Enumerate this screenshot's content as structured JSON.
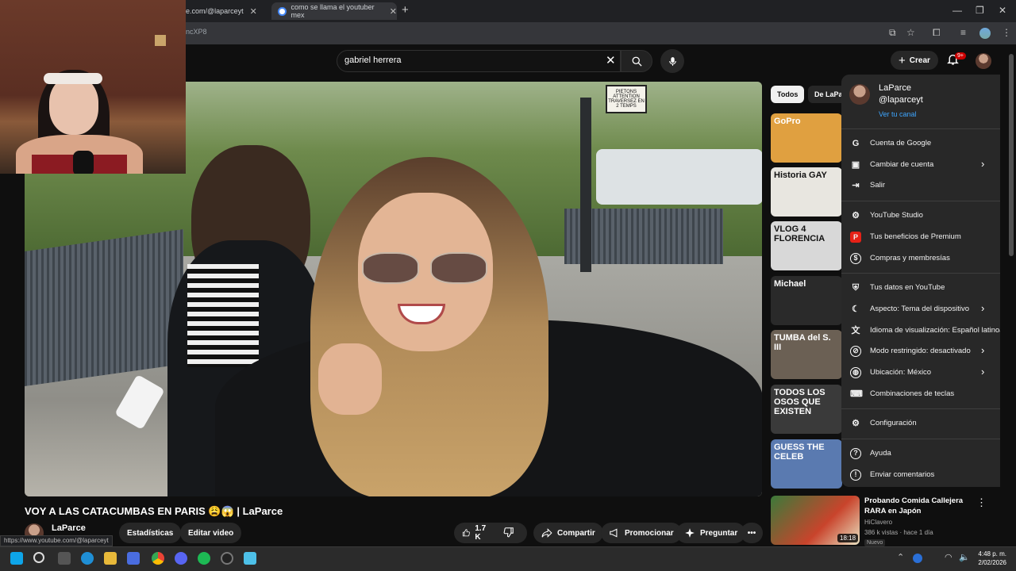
{
  "browser": {
    "tab1_label": "e.com/@laparceyt",
    "tab2_label": "como se llama el youtuber mex",
    "new_tab": "+",
    "address": "ncXP8",
    "status_url": "https://www.youtube.com/@laparceyt"
  },
  "header": {
    "search_value": "gabriel herrera",
    "create_label": "Crear",
    "notif_badge": "9+"
  },
  "video": {
    "title": "VOY A LAS CATACUMBAS EN PARIS 😩😱 | LaParce",
    "channel": "LaParce",
    "sign_text": "PIETONS ATTENTION TRAVERSEZ EN 2 TEMPS",
    "buttons": {
      "stats": "Estadísticas",
      "edit": "Editar video",
      "likes": "1.7 K",
      "share": "Compartir",
      "promote": "Promocionar",
      "ask": "Preguntar",
      "more": "•••"
    }
  },
  "sidebar": {
    "chips": [
      "Todos",
      "De LaPa"
    ],
    "thumbs": [
      {
        "text": "GoPro",
        "color": "#e0a040"
      },
      {
        "text": "Historia GAY",
        "color": "#e8e6e0"
      },
      {
        "text": "VLOG 4 FLORENCIA",
        "color": "#d8d8d8"
      },
      {
        "text": "Michael",
        "color": "#2a2a2a"
      },
      {
        "text": "TUMBA del S. III",
        "color": "#6b6054"
      },
      {
        "text": "TODOS LOS OSOS QUE EXISTEN",
        "color": "#3a3a3a"
      },
      {
        "text": "GUESS THE CELEB",
        "color": "#5a7ab0"
      }
    ],
    "recommendation": {
      "title": "Probando Comida Callejera RARA en Japón",
      "channel": "HiClavero",
      "meta": "386 k vistas · hace 1 día",
      "badge": "Nuevo",
      "duration": "18:18"
    }
  },
  "account_menu": {
    "name": "LaParce",
    "handle": "@laparceyt",
    "view_channel": "Ver tu canal",
    "groups": [
      [
        {
          "label": "Cuenta de Google",
          "icon": "google-icon",
          "chevron": false
        },
        {
          "label": "Cambiar de cuenta",
          "icon": "switch-account-icon",
          "chevron": true
        },
        {
          "label": "Salir",
          "icon": "sign-out-icon",
          "chevron": false
        }
      ],
      [
        {
          "label": "YouTube Studio",
          "icon": "studio-icon",
          "chevron": false
        },
        {
          "label": "Tus beneficios de Premium",
          "icon": "premium-icon",
          "chevron": false
        },
        {
          "label": "Compras y membresías",
          "icon": "dollar-icon",
          "chevron": false
        }
      ],
      [
        {
          "label": "Tus datos en YouTube",
          "icon": "shield-icon",
          "chevron": false
        },
        {
          "label": "Aspecto: Tema del dispositivo",
          "icon": "moon-icon",
          "chevron": true
        },
        {
          "label": "Idioma de visualización: Español latinoa",
          "icon": "translate-icon",
          "chevron": false
        },
        {
          "label": "Modo restringido: desactivado",
          "icon": "restricted-icon",
          "chevron": true
        },
        {
          "label": "Ubicación: México",
          "icon": "globe-icon",
          "chevron": true
        },
        {
          "label": "Combinaciones de teclas",
          "icon": "keyboard-icon",
          "chevron": false
        }
      ],
      [
        {
          "label": "Configuración",
          "icon": "settings-icon",
          "chevron": false
        }
      ],
      [
        {
          "label": "Ayuda",
          "icon": "help-icon",
          "chevron": false
        },
        {
          "label": "Enviar comentarios",
          "icon": "feedback-icon",
          "chevron": false
        }
      ]
    ]
  },
  "taskbar": {
    "time": "4:48 p. m.",
    "date": "2/02/2026"
  }
}
